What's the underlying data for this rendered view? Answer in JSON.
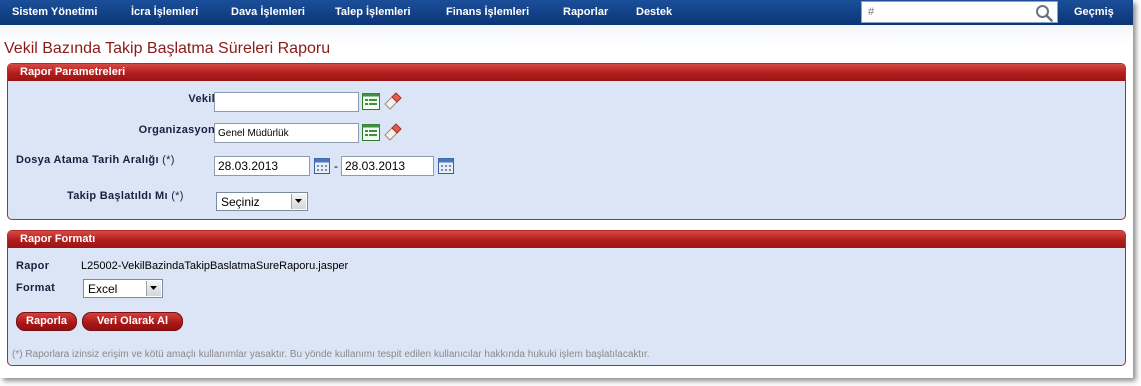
{
  "nav": {
    "items": [
      "Sistem Yönetimi",
      "İcra İşlemleri",
      "Dava İşlemleri",
      "Talep İşlemleri",
      "Finans İşlemleri",
      "Raporlar",
      "Destek"
    ],
    "search_placeholder": "#",
    "history_label": "Geçmiş"
  },
  "page": {
    "title": "Vekil Bazında Takip Başlatma Süreleri Raporu"
  },
  "params": {
    "header": "Rapor Parametreleri",
    "vekil_label": "Vekil",
    "vekil_value": "",
    "org_label": "Organizasyon",
    "org_value": "Genel Müdürlük",
    "date_label": "Dosya Atama Tarih Aralığı",
    "required_mark": "(*)",
    "date_from": "28.03.2013",
    "date_sep": "-",
    "date_to": "28.03.2013",
    "started_label": "Takip Başlatıldı Mı",
    "started_value": "Seçiniz"
  },
  "format": {
    "header": "Rapor Formatı",
    "report_label": "Rapor",
    "report_value": "L25002-VekilBazindaTakipBaslatmaSureRaporu.jasper",
    "format_label": "Format",
    "format_value": "Excel",
    "report_button": "Raporla",
    "data_button": "Veri Olarak Al",
    "note": "(*) Raporlara izinsiz erişim ve kötü amaçlı kullanımlar yasaktır. Bu yönde kullanımı tespit edilen kullanıcılar hakkında hukuki işlem başlatılacaktır."
  },
  "colors": {
    "nav_bg": "#0c3576",
    "title": "#8b1a1a",
    "panel_bg": "#dbe5f5",
    "panel_header": "#b21c1c"
  }
}
